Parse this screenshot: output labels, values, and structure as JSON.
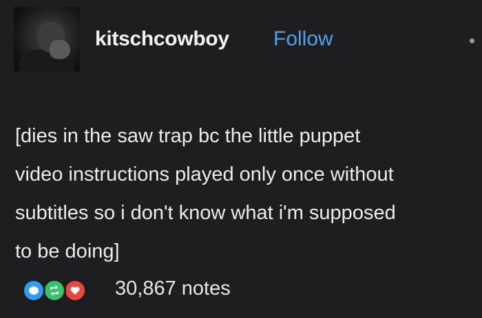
{
  "header": {
    "username": "kitschcowboy",
    "follow_label": "Follow"
  },
  "post": {
    "text": "[dies in the saw trap bc the little puppet\nvideo instructions played only once without\nsubtitles so i don't know what i'm supposed\nto be doing]"
  },
  "footer": {
    "notes_count": "30,867 notes",
    "note_icons": [
      "reply-icon",
      "reblog-icon",
      "like-icon"
    ]
  },
  "colors": {
    "background": "#1e1e20",
    "follow": "#4fa3e8",
    "reply": "#2e9cf0",
    "reblog": "#35c46a",
    "like": "#e8473f"
  }
}
